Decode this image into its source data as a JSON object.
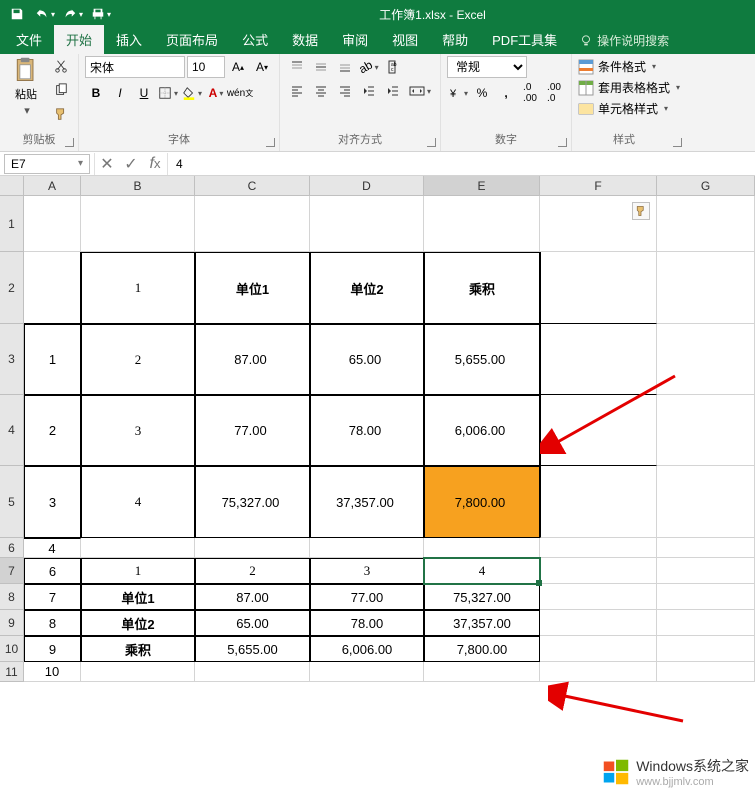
{
  "titlebar": {
    "title": "工作簿1.xlsx - Excel"
  },
  "tabs": {
    "file": "文件",
    "home": "开始",
    "insert": "插入",
    "layout": "页面布局",
    "formulas": "公式",
    "data": "数据",
    "review": "审阅",
    "view": "视图",
    "help": "帮助",
    "pdf": "PDF工具集",
    "tellme": "操作说明搜索"
  },
  "ribbon": {
    "clipboard": {
      "label": "剪贴板",
      "paste": "粘贴"
    },
    "font": {
      "label": "字体",
      "name": "宋体",
      "size": "10",
      "bold": "B",
      "italic": "I",
      "underline": "U"
    },
    "alignment": {
      "label": "对齐方式"
    },
    "number": {
      "label": "数字",
      "format": "常规",
      "percent": "%",
      "comma": ","
    },
    "styles": {
      "label": "样式",
      "cond": "条件格式",
      "table": "套用表格格式",
      "cell": "单元格样式"
    }
  },
  "formula_bar": {
    "name_box": "E7",
    "formula": "4"
  },
  "columns": [
    "A",
    "B",
    "C",
    "D",
    "E",
    "F",
    "G"
  ],
  "rows": [
    "1",
    "2",
    "3",
    "4",
    "5",
    "6",
    "7",
    "8",
    "9",
    "10",
    "11"
  ],
  "sheet": {
    "r2": {
      "B": "1",
      "C": "单位1",
      "D": "单位2",
      "E": "乘积"
    },
    "r3": {
      "A": "1",
      "B": "2",
      "C": "87.00",
      "D": "65.00",
      "E": "5,655.00"
    },
    "r4": {
      "A": "2",
      "B": "3",
      "C": "77.00",
      "D": "78.00",
      "E": "6,006.00"
    },
    "r5": {
      "A": "3",
      "B": "4",
      "C": "75,327.00",
      "D": "37,357.00",
      "E": "7,800.00"
    },
    "r6": {
      "A": "4"
    },
    "r7": {
      "A": "6",
      "B": "1",
      "C": "2",
      "D": "3",
      "E": "4"
    },
    "r8": {
      "A": "7",
      "B": "单位1",
      "C": "87.00",
      "D": "77.00",
      "E": "75,327.00"
    },
    "r9": {
      "A": "8",
      "B": "单位2",
      "C": "65.00",
      "D": "78.00",
      "E": "37,357.00"
    },
    "r10": {
      "A": "9",
      "B": "乘积",
      "C": "5,655.00",
      "D": "6,006.00",
      "E": "7,800.00"
    },
    "r11": {
      "A": "10"
    }
  },
  "watermark": {
    "line1": "Windows系统之家",
    "line2": "www.bjjmlv.com"
  }
}
